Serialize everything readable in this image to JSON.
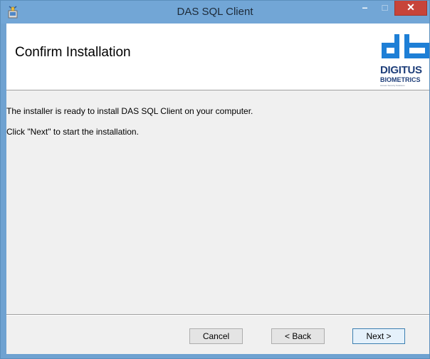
{
  "window": {
    "title": "DAS SQL Client",
    "minimize_glyph": "–",
    "maximize_glyph": "□",
    "close_glyph": "✕"
  },
  "banner": {
    "heading": "Confirm Installation",
    "logo": {
      "name": "digitus-biometrics-logo",
      "brand_line1": "DIGITUS",
      "brand_line2": "BIOMETRICS",
      "tagline": "Access Security Solutions"
    }
  },
  "content": {
    "line1": "The installer is ready to install DAS SQL Client on your computer.",
    "line2": "Click \"Next\" to start the installation."
  },
  "buttons": {
    "cancel": "Cancel",
    "back": "< Back",
    "next": "Next >"
  },
  "colors": {
    "titlebar": "#72a6d6",
    "close_button": "#c7443a",
    "logo_blue": "#1e7fd6",
    "logo_text": "#1f3f7a",
    "dialog_background": "#f0f0f0"
  }
}
